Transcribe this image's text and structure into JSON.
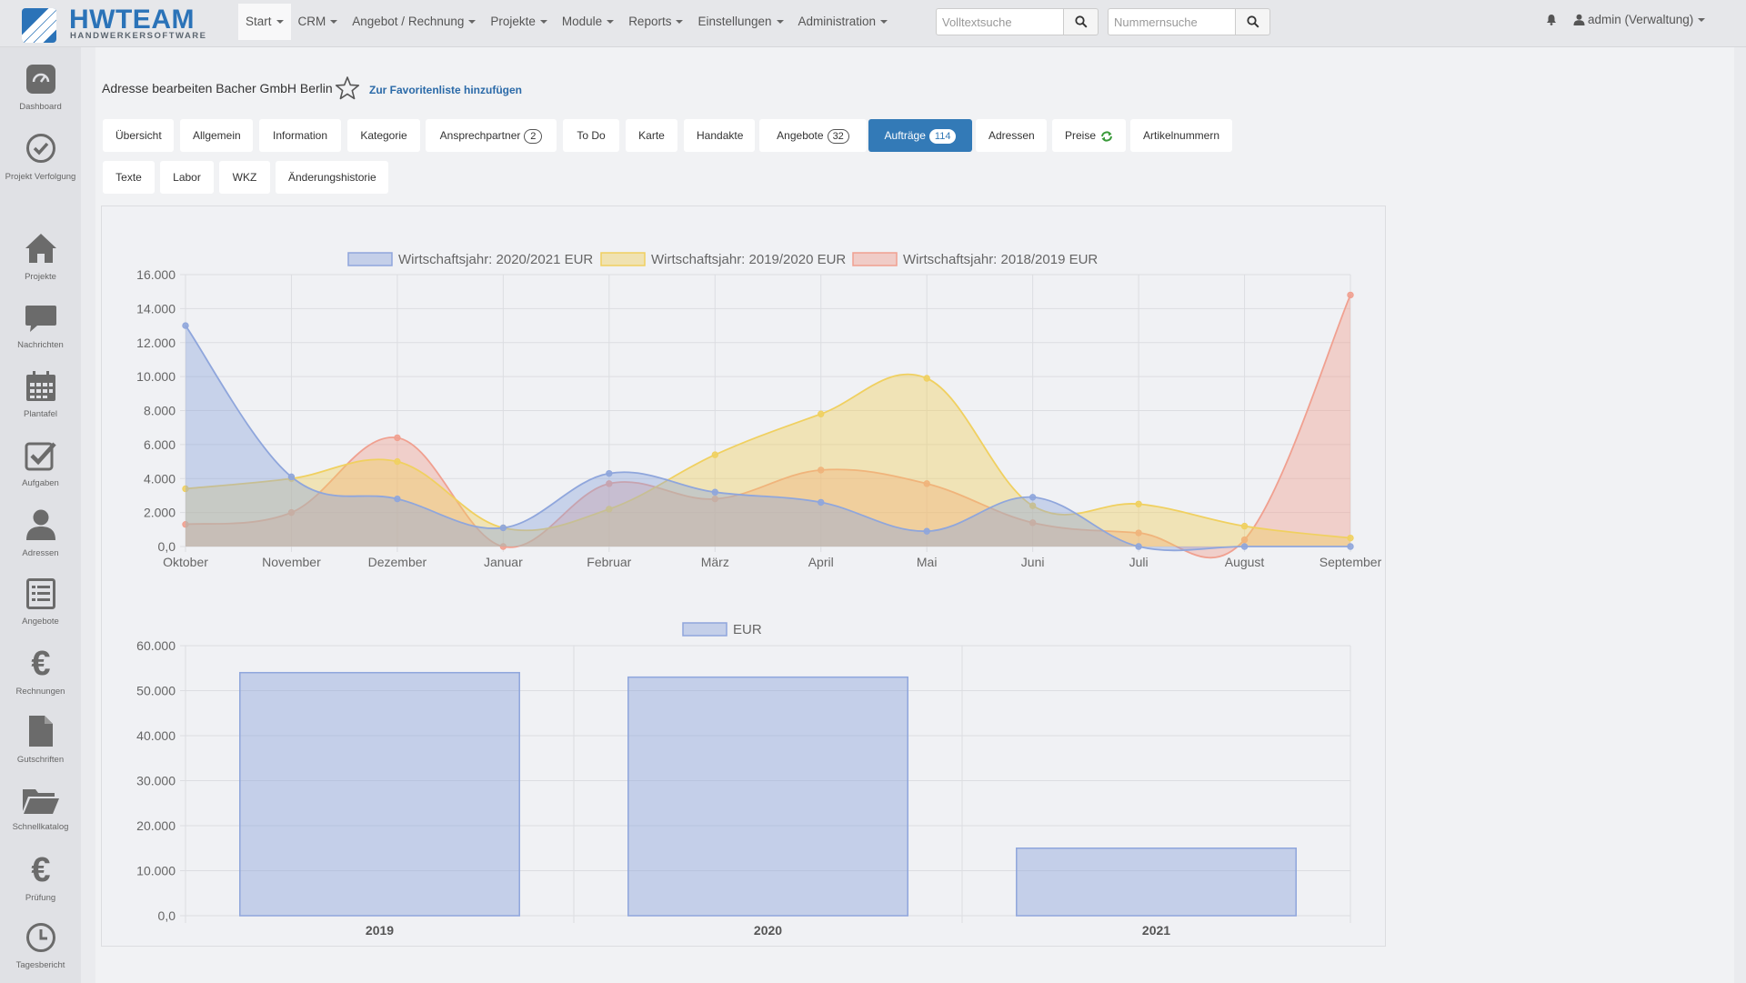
{
  "app": {
    "logo_title": "HWTEAM",
    "logo_subtitle": "HANDWERKERSOFTWARE",
    "brand_color": "#2b73b8"
  },
  "menu": {
    "items": [
      {
        "label": "Start"
      },
      {
        "label": "CRM"
      },
      {
        "label": "Angebot / Rechnung"
      },
      {
        "label": "Projekte"
      },
      {
        "label": "Module"
      },
      {
        "label": "Reports"
      },
      {
        "label": "Einstellungen"
      },
      {
        "label": "Administration"
      }
    ],
    "active": "Start"
  },
  "search": {
    "fulltext_placeholder": "Volltextsuche",
    "number_placeholder": "Nummernsuche",
    "icon": "search-icon"
  },
  "user": {
    "label": "admin (Verwaltung)",
    "bell_icon": "bell-icon",
    "user_icon": "user-icon"
  },
  "sidebar": {
    "items": [
      {
        "label": "Dashboard",
        "icon": "dashboard-icon"
      },
      {
        "label": "Projekt Verfolgung",
        "icon": "check-circle-icon"
      },
      {
        "label": "Projekte",
        "icon": "home-icon"
      },
      {
        "label": "Nachrichten",
        "icon": "comment-icon"
      },
      {
        "label": "Plantafel",
        "icon": "calendar-icon"
      },
      {
        "label": "Aufgaben",
        "icon": "checkbox-icon"
      },
      {
        "label": "Adressen",
        "icon": "user-icon"
      },
      {
        "label": "Angebote",
        "icon": "list-icon"
      },
      {
        "label": "Rechnungen",
        "icon": "euro-icon"
      },
      {
        "label": "Gutschriften",
        "icon": "file-icon"
      },
      {
        "label": "Schnellkatalog",
        "icon": "folder-open-icon"
      },
      {
        "label": "Prüfung",
        "icon": "euro-icon"
      },
      {
        "label": "Tagesbericht",
        "icon": "clock-icon"
      }
    ]
  },
  "page": {
    "title": "Adresse bearbeiten Bacher GmbH Berlin",
    "favorite_link": "Zur Favoritenliste hinzufügen",
    "favorite_icon": "star-icon"
  },
  "tabs": {
    "row1": [
      {
        "label": "Übersicht"
      },
      {
        "label": "Allgemein"
      },
      {
        "label": "Information"
      },
      {
        "label": "Kategorie"
      },
      {
        "label": "Ansprechpartner",
        "badge": "2"
      },
      {
        "label": "To Do"
      },
      {
        "label": "Karte"
      },
      {
        "label": "Handakte"
      },
      {
        "label": "Angebote",
        "badge": "32"
      },
      {
        "label": "Aufträge",
        "badge": "114",
        "active": true
      },
      {
        "label": "Adressen"
      },
      {
        "label": "Preise",
        "icon": "refresh-icon"
      },
      {
        "label": "Artikelnummern"
      }
    ],
    "row2": [
      {
        "label": "Texte"
      },
      {
        "label": "Labor"
      },
      {
        "label": "WKZ"
      },
      {
        "label": "Änderungshistorie"
      }
    ],
    "active_color": "#337ab7"
  },
  "chart_data": [
    {
      "type": "area",
      "categories": [
        "Oktober",
        "November",
        "Dezember",
        "Januar",
        "Februar",
        "März",
        "April",
        "Mai",
        "Juni",
        "Juli",
        "August",
        "September"
      ],
      "ylim": [
        0,
        16000
      ],
      "y_ticks": [
        "0,0",
        "2.000",
        "4.000",
        "6.000",
        "8.000",
        "10.000",
        "12.000",
        "14.000",
        "16.000"
      ],
      "grid": true,
      "legend_position": "top",
      "series": [
        {
          "name": "Wirtschaftsjahr: 2020/2021 EUR",
          "color": "#8fa6dc",
          "values": [
            13000,
            4100,
            2800,
            1100,
            4300,
            3200,
            2600,
            900,
            2900,
            0,
            0,
            0
          ]
        },
        {
          "name": "Wirtschaftsjahr: 2019/2020 EUR",
          "color": "#f0d060",
          "values": [
            3400,
            4000,
            5000,
            1100,
            2200,
            5400,
            7800,
            9900,
            2400,
            2500,
            1200,
            500
          ]
        },
        {
          "name": "Wirtschaftsjahr: 2018/2019 EUR",
          "color": "#f0a090",
          "values": [
            1300,
            2000,
            6400,
            0,
            3700,
            2800,
            4500,
            3700,
            1400,
            800,
            400,
            14800
          ]
        }
      ]
    },
    {
      "type": "bar",
      "categories": [
        "2019",
        "2020",
        "2021"
      ],
      "ylim": [
        0,
        60000
      ],
      "y_ticks": [
        "0,0",
        "10.000",
        "20.000",
        "30.000",
        "40.000",
        "50.000",
        "60.000"
      ],
      "grid": true,
      "legend_position": "top",
      "series": [
        {
          "name": "EUR",
          "color": "#8fa6dc",
          "values": [
            54000,
            53000,
            15000
          ]
        }
      ]
    }
  ]
}
